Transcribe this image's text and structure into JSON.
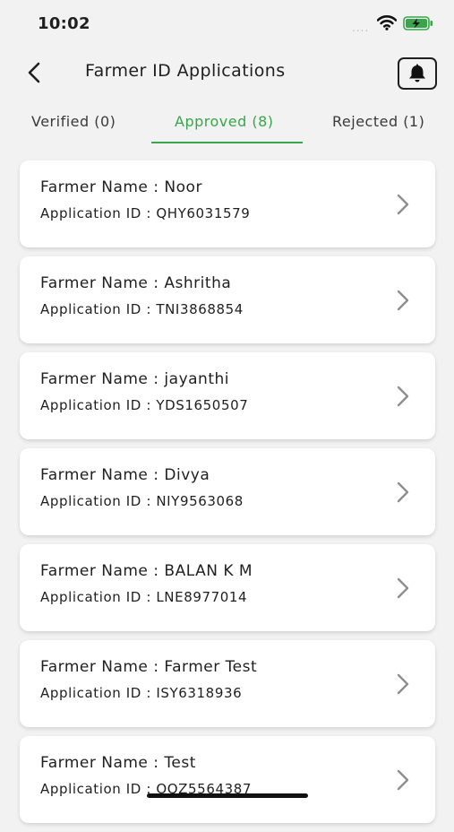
{
  "status_bar": {
    "time": "10:02",
    "signal": "...."
  },
  "header": {
    "title": "Farmer ID Applications"
  },
  "tabs": [
    {
      "label": "Verified (0)"
    },
    {
      "label": "Approved (8)"
    },
    {
      "label": "Rejected (1)"
    }
  ],
  "applications": [
    {
      "farmer": "Farmer Name : Noor",
      "app_id": "Application ID : QHY6031579"
    },
    {
      "farmer": "Farmer Name : Ashritha",
      "app_id": "Application ID : TNI3868854"
    },
    {
      "farmer": "Farmer Name : jayanthi",
      "app_id": "Application ID : YDS1650507"
    },
    {
      "farmer": "Farmer Name : Divya",
      "app_id": "Application ID : NIY9563068"
    },
    {
      "farmer": "Farmer Name : BALAN K M",
      "app_id": "Application ID : LNE8977014"
    },
    {
      "farmer": "Farmer Name : Farmer Test",
      "app_id": "Application ID : ISY6318936"
    },
    {
      "farmer": "Farmer Name : Test",
      "app_id": "Application ID : OQZ5564387"
    }
  ],
  "colors": {
    "accent": "#3aa64b",
    "background": "#f2f2f2",
    "card": "#ffffff"
  },
  "icons": [
    "back-arrow-icon",
    "bell-icon",
    "chevron-right-icon",
    "wifi-icon",
    "battery-charging-icon"
  ]
}
